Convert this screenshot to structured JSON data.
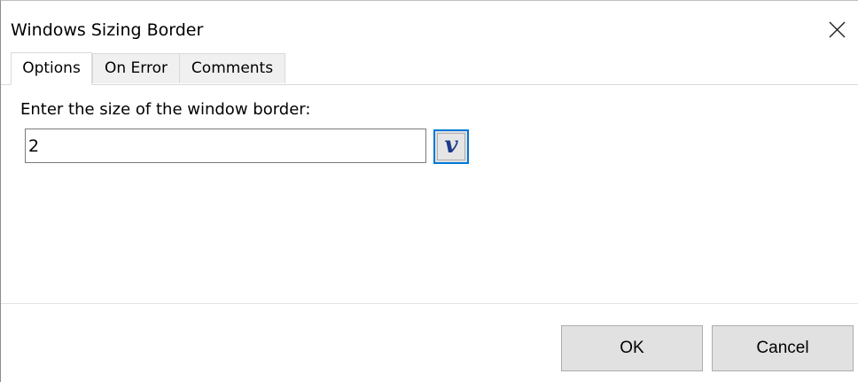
{
  "window": {
    "title": "Windows Sizing Border"
  },
  "tabs": [
    {
      "label": "Options",
      "active": true
    },
    {
      "label": "On Error",
      "active": false
    },
    {
      "label": "Comments",
      "active": false
    }
  ],
  "options": {
    "border_size_label": "Enter the size of the window border:",
    "border_size_value": "2",
    "variable_button_glyph": "v"
  },
  "footer": {
    "ok_label": "OK",
    "cancel_label": "Cancel"
  },
  "icons": {
    "close": "close-icon"
  },
  "colors": {
    "focus_accent": "#0078d7",
    "button_face": "#e1e1e1",
    "variable_glyph": "#1e3a8a"
  }
}
